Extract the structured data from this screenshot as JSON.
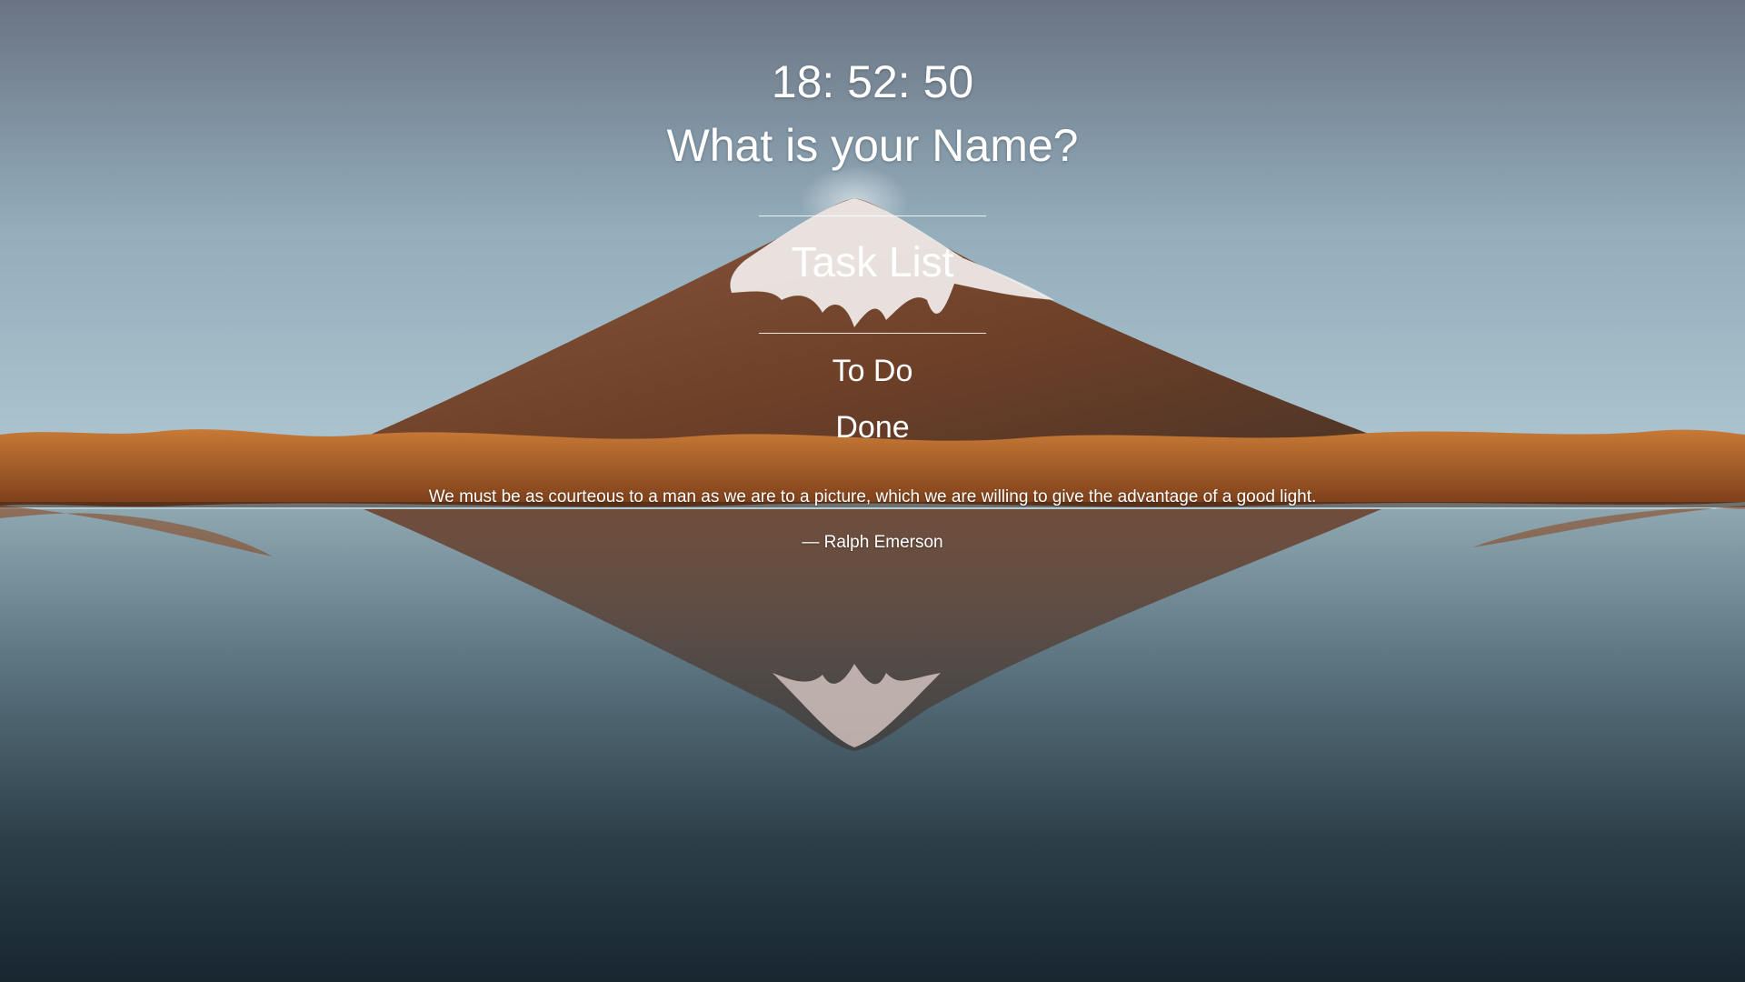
{
  "clock": {
    "time": "18: 52: 50"
  },
  "greeting": {
    "prompt": "What is your Name?"
  },
  "tasks": {
    "title": "Task List",
    "todo_label": "To Do",
    "done_label": "Done"
  },
  "quote": {
    "text": "We must be as courteous to a man as we are to a picture, which we are willing to give the advantage of a good light.",
    "author": "— Ralph Emerson"
  },
  "colors": {
    "text": "#ffffff",
    "sky_top": "#6b7585",
    "sky_horizon": "#a6c0cd",
    "mountain": "#7a4a32",
    "grass": "#b8652a",
    "water": "#1f2f38"
  }
}
